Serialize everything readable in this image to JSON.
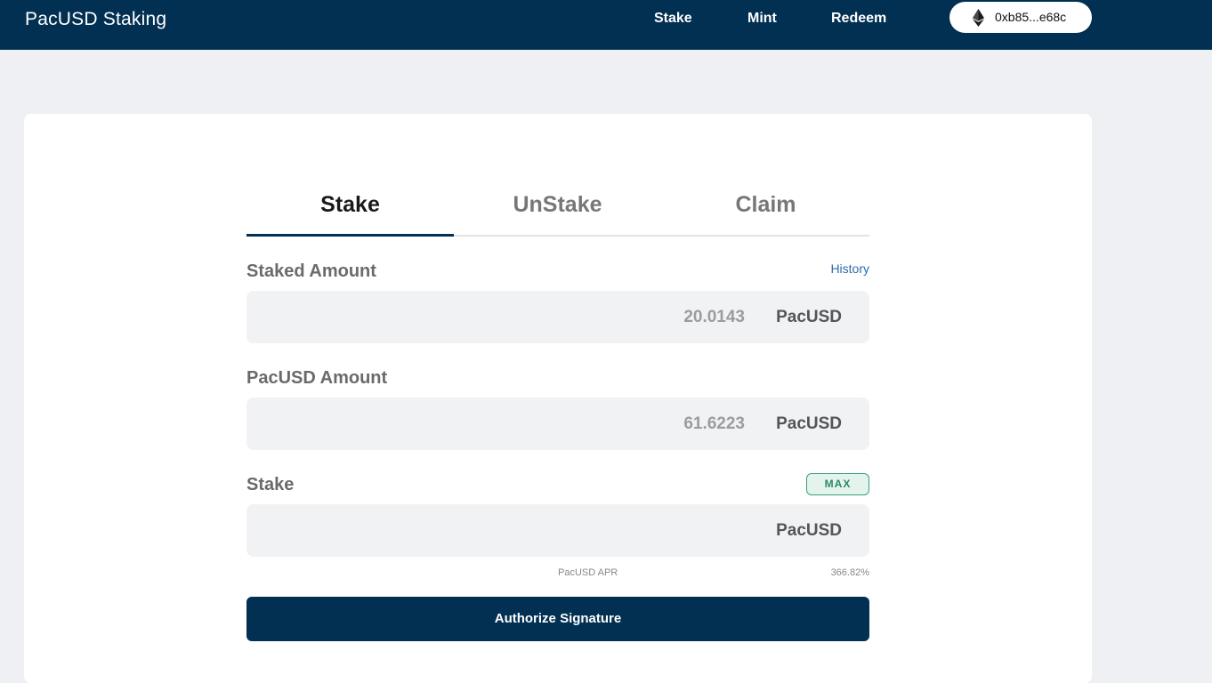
{
  "header": {
    "brand": "PacUSD Staking",
    "nav": {
      "stake": "Stake",
      "mint": "Mint",
      "redeem": "Redeem"
    },
    "wallet": {
      "icon": "ethereum-icon",
      "address": "0xb85...e68c"
    }
  },
  "tabs": {
    "items": [
      "Stake",
      "UnStake",
      "Claim"
    ],
    "active": "Stake"
  },
  "staked": {
    "label": "Staked Amount",
    "history_link": "History",
    "value": "20.0143",
    "unit": "PacUSD"
  },
  "pacusd": {
    "label": "PacUSD Amount",
    "value": "61.6223",
    "unit": "PacUSD"
  },
  "stake_input": {
    "label": "Stake",
    "max_label": "MAX",
    "value": "",
    "placeholder": "",
    "unit": "PacUSD"
  },
  "apr": {
    "label": "PacUSD APR",
    "value": "366.82%"
  },
  "action": {
    "label": "Authorize Signature"
  },
  "colors": {
    "primary": "#023052",
    "background": "#eff0f3",
    "link": "#2b6cb0",
    "max_border": "#3aa07a"
  }
}
